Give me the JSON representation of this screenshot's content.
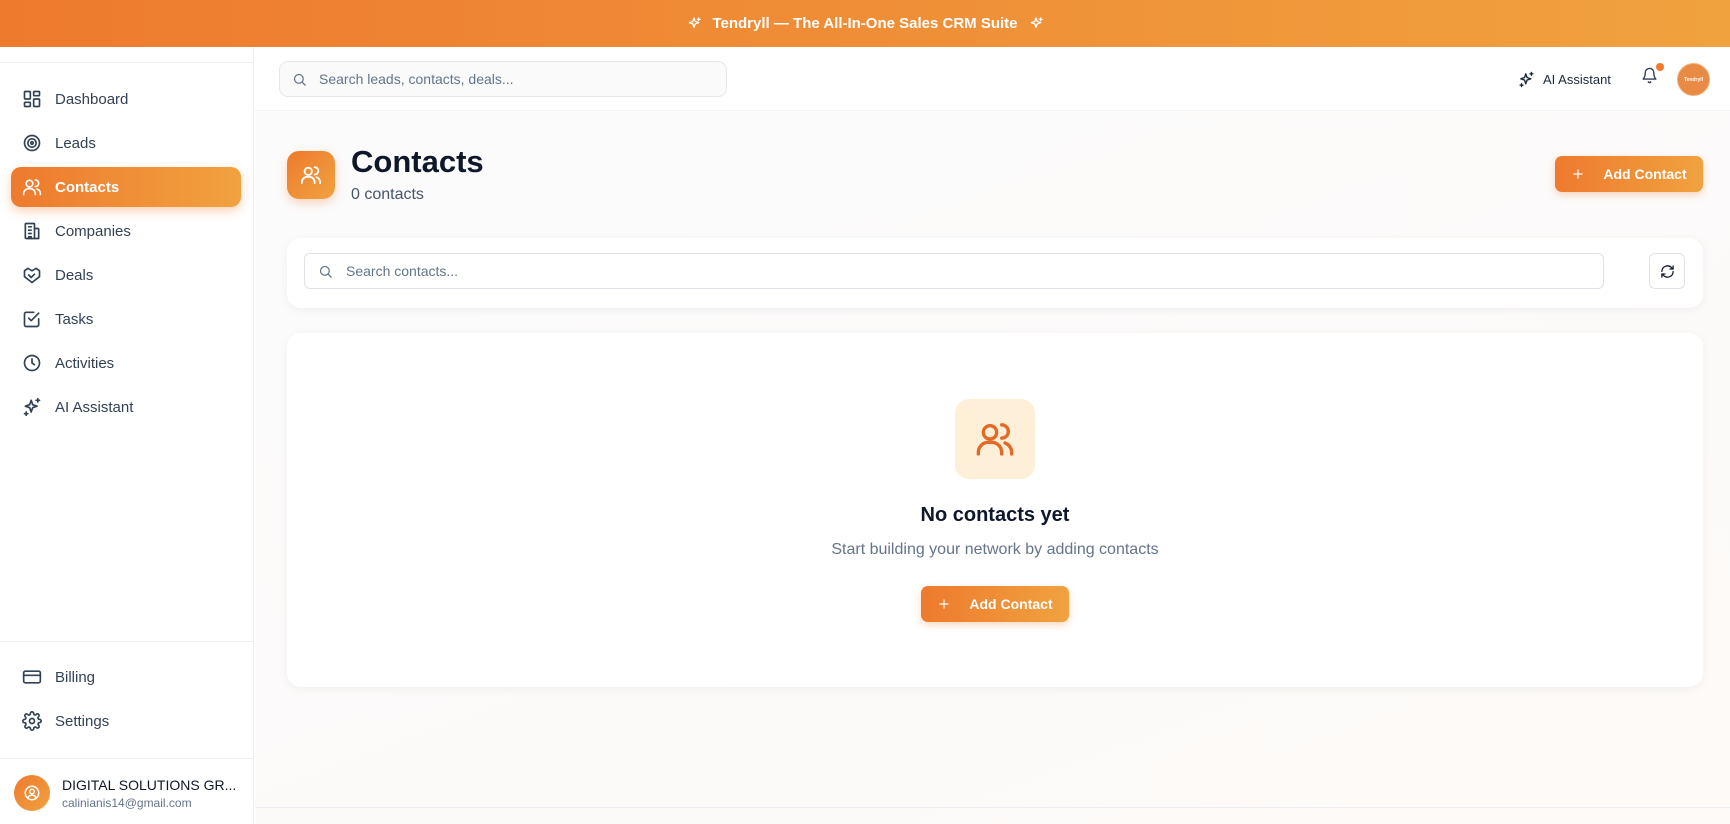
{
  "banner": {
    "text": "Tendryll — The All-In-One Sales CRM Suite",
    "icon": "sparkles-icon"
  },
  "topbar": {
    "search_placeholder": "Search leads, contacts, deals...",
    "ai_assistant_label": "AI Assistant",
    "avatar_text": "Tendryll"
  },
  "sidebar": {
    "items": [
      {
        "label": "Dashboard",
        "icon": "dashboard-icon"
      },
      {
        "label": "Leads",
        "icon": "target-icon"
      },
      {
        "label": "Contacts",
        "icon": "users-icon",
        "active": true
      },
      {
        "label": "Companies",
        "icon": "building-icon"
      },
      {
        "label": "Deals",
        "icon": "handshake-icon"
      },
      {
        "label": "Tasks",
        "icon": "checkbox-icon"
      },
      {
        "label": "Activities",
        "icon": "clock-icon"
      },
      {
        "label": "AI Assistant",
        "icon": "sparkles-icon"
      }
    ],
    "bottom_items": [
      {
        "label": "Billing",
        "icon": "credit-card-icon"
      },
      {
        "label": "Settings",
        "icon": "gear-icon"
      }
    ],
    "user": {
      "name": "DIGITAL SOLUTIONS GR...",
      "email": "calinianis14@gmail.com"
    }
  },
  "page": {
    "title": "Contacts",
    "count_text": "0 contacts",
    "add_button_label": "Add Contact",
    "search_placeholder": "Search contacts..."
  },
  "empty_state": {
    "title": "No contacts yet",
    "subtitle": "Start building your network by adding contacts",
    "button_label": "Add Contact"
  },
  "colors": {
    "accent_start": "#ee7a2e",
    "accent_end": "#f0a23f",
    "empty_icon_bg": "#feefd9"
  }
}
